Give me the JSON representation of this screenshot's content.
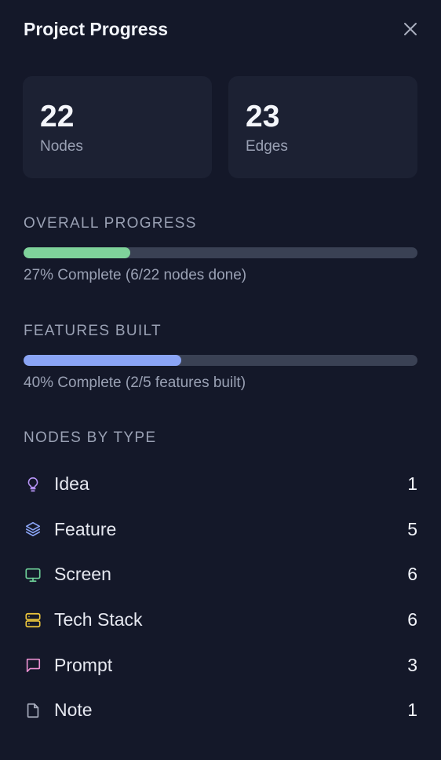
{
  "header": {
    "title": "Project Progress"
  },
  "stats": [
    {
      "value": "22",
      "label": "Nodes"
    },
    {
      "value": "23",
      "label": "Edges"
    }
  ],
  "overall": {
    "title": "OVERALL PROGRESS",
    "fraction": 0.27,
    "caption": "27% Complete (6/22 nodes done)",
    "color": "#7fd39b"
  },
  "features": {
    "title": "FEATURES BUILT",
    "fraction": 0.4,
    "caption": "40% Complete (2/5 features built)",
    "color": "#8aa4f5"
  },
  "types": {
    "title": "NODES BY TYPE",
    "items": [
      {
        "label": "Idea",
        "count": "1",
        "icon": "lightbulb-icon",
        "color": "#b794f6"
      },
      {
        "label": "Feature",
        "count": "5",
        "icon": "layers-icon",
        "color": "#8aa4f5"
      },
      {
        "label": "Screen",
        "count": "6",
        "icon": "monitor-icon",
        "color": "#6fd29a"
      },
      {
        "label": "Tech Stack",
        "count": "6",
        "icon": "server-icon",
        "color": "#f0c93c"
      },
      {
        "label": "Prompt",
        "count": "3",
        "icon": "message-icon",
        "color": "#e98fd0"
      },
      {
        "label": "Note",
        "count": "1",
        "icon": "file-icon",
        "color": "#a8adbd"
      }
    ]
  }
}
